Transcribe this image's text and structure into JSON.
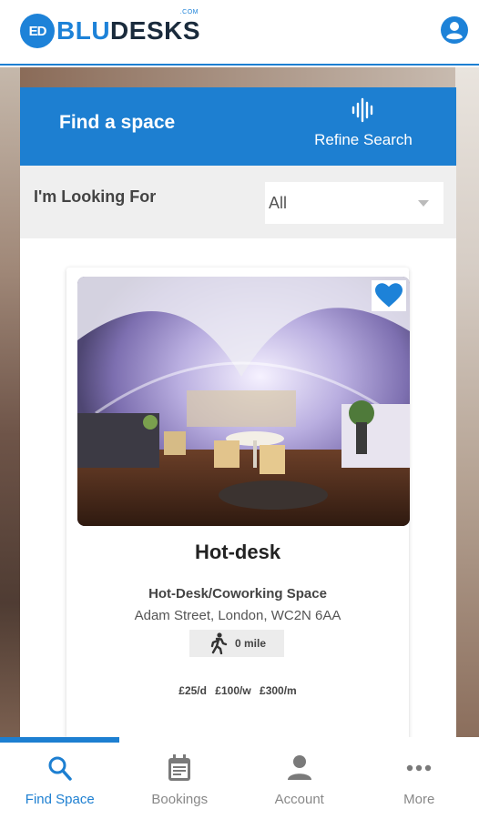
{
  "header": {
    "logo_badge": "ED",
    "logo_part1": "BLU",
    "logo_part2": "DESKS",
    "logo_com": ".COM",
    "account_icon": "account-circle-icon"
  },
  "search_panel": {
    "title": "Find a space",
    "refine_label": "Refine Search",
    "refine_icon": "sound-wave-icon"
  },
  "filter": {
    "label": "I'm Looking For",
    "selected": "All"
  },
  "listing": {
    "title": "Hot-desk",
    "type": "Hot-Desk/Coworking Space",
    "address": "Adam Street, London, WC2N 6AA",
    "distance": "0 mile",
    "distance_icon": "walking-person-icon",
    "favorite_icon": "heart-icon",
    "prices": {
      "daily": "£25/d",
      "weekly": "£100/w",
      "monthly": "£300/m"
    }
  },
  "bottom_nav": {
    "items": [
      {
        "label": "Find Space",
        "icon": "search-icon",
        "active": true
      },
      {
        "label": "Bookings",
        "icon": "calendar-icon",
        "active": false
      },
      {
        "label": "Account",
        "icon": "person-icon",
        "active": false
      },
      {
        "label": "More",
        "icon": "more-dots-icon",
        "active": false
      }
    ]
  },
  "colors": {
    "brand_blue": "#1d7fd1",
    "logo_dark": "#1a2b3c",
    "nav_inactive": "#888888"
  }
}
